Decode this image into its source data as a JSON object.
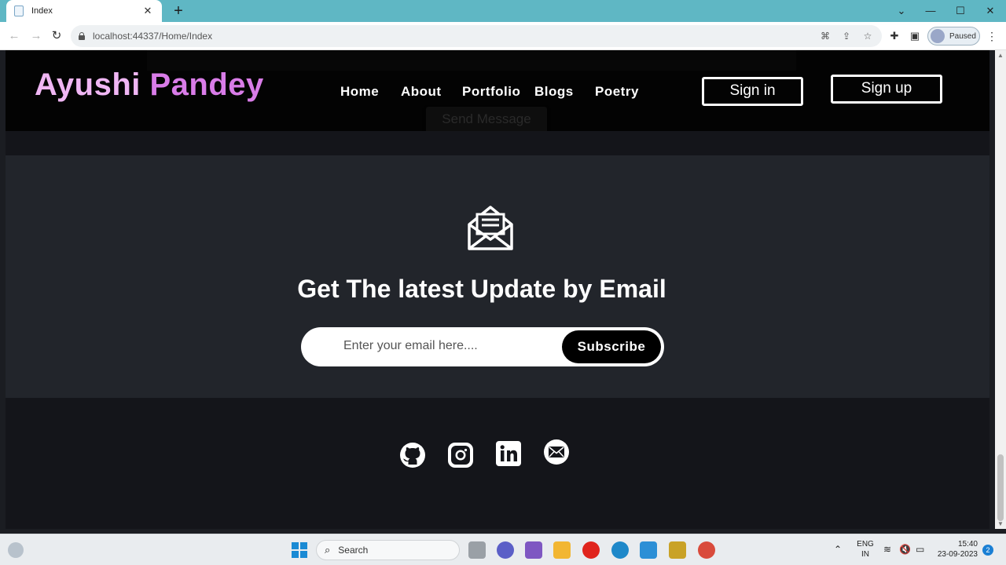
{
  "browser": {
    "tab_title": "Index",
    "url": "localhost:44337/Home/Index",
    "profile_status": "Paused"
  },
  "site": {
    "brand_first": "Ayushi",
    "brand_last": "Pandey",
    "nav": [
      "Home",
      "About",
      "Portfolio",
      "Blogs",
      "Poetry"
    ],
    "sign_in_label": "Sign in",
    "sign_up_label": "Sign up",
    "ghost_button_label": "Send Message"
  },
  "subscribe": {
    "title": "Get The latest Update by Email",
    "email_placeholder": "Enter your email here....",
    "button_label": "Subscribe"
  },
  "footer": {
    "social_icons": [
      "github-icon",
      "instagram-icon",
      "linkedin-icon",
      "mail-icon"
    ]
  },
  "taskbar": {
    "search_label": "Search",
    "language_primary": "ENG",
    "language_secondary": "IN",
    "time": "15:40",
    "date": "23-09-2023",
    "notification_count": "2"
  },
  "colors": {
    "brand_first": "#f0b6f4",
    "brand_last": "#d97ce8",
    "section_bg": "#22252b",
    "footer_bg": "#14151a",
    "tabstrip": "#5fb7c4"
  }
}
